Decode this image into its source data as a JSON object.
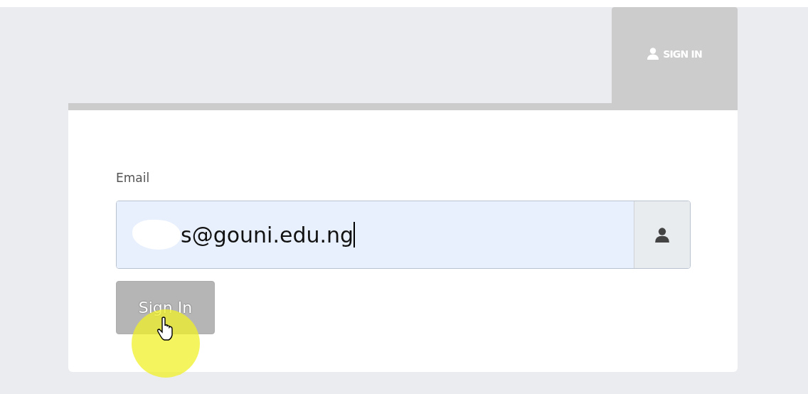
{
  "tab": {
    "label": "SIGN IN",
    "selected": true
  },
  "form": {
    "email_label": "Email",
    "email_value": "s@gouni.edu.ng",
    "focused": true,
    "redacted": true
  },
  "button": {
    "label": "Sign In",
    "disabled": true
  },
  "pointer": {
    "highlighted": true
  }
}
